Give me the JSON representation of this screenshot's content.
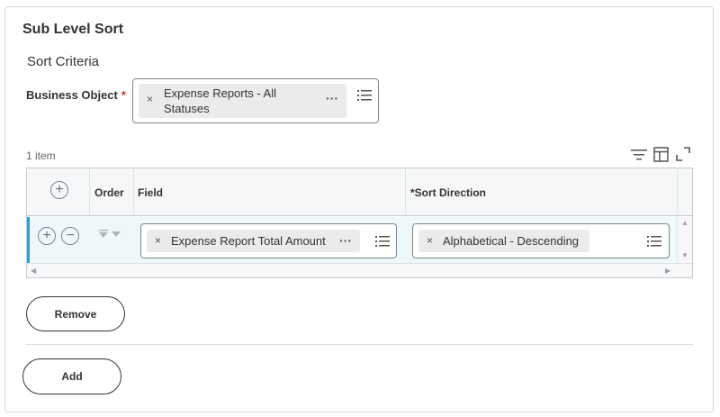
{
  "header": {
    "title": "Sub Level Sort"
  },
  "section": {
    "title": "Sort Criteria"
  },
  "business_object": {
    "label": "Business Object",
    "required_mark": "*",
    "value_line1": "Expense Reports - All",
    "value_line2": "Statuses",
    "remove_glyph": "×",
    "more_glyph": "···"
  },
  "grid": {
    "item_count": "1 item",
    "columns": {
      "order": "Order",
      "field": "Field",
      "sort_direction": "*Sort Direction"
    },
    "rows": [
      {
        "field_value": "Expense Report Total Amount",
        "sort_direction_value": "Alphabetical - Descending"
      }
    ],
    "add_glyph": "+",
    "remove_glyph": "−",
    "pill_remove_glyph": "×",
    "more_glyph": "···"
  },
  "actions": {
    "remove_label": "Remove",
    "add_label": "Add"
  },
  "icons": {
    "filter": "filter-icon",
    "columns": "columns-icon",
    "expand": "expand-icon",
    "list": "list-icon"
  },
  "colors": {
    "required": "#de2e21",
    "accent": "#2e9ed9",
    "row_bg": "#eef8fb"
  }
}
